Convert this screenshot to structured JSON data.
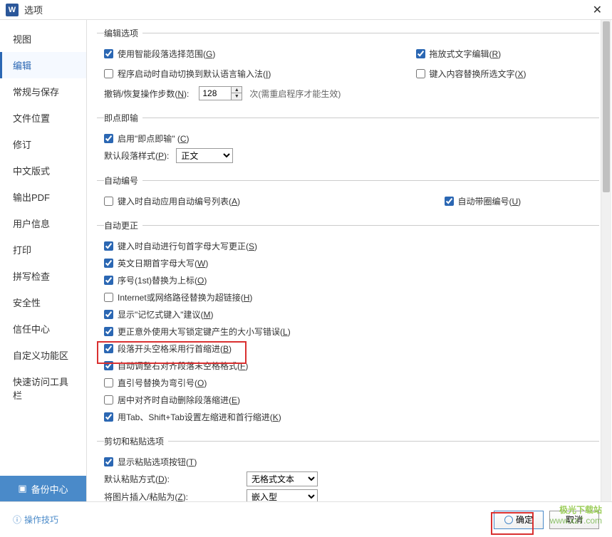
{
  "titlebar": {
    "title": "选项"
  },
  "sidebar": {
    "items": [
      "视图",
      "编辑",
      "常规与保存",
      "文件位置",
      "修订",
      "中文版式",
      "输出PDF",
      "用户信息",
      "打印",
      "拼写检查",
      "安全性",
      "信任中心",
      "自定义功能区",
      "快速访问工具栏"
    ],
    "selected_index": 1,
    "backup": "备份中心"
  },
  "sections": {
    "edit_options": {
      "legend": "编辑选项",
      "smart_select": "使用智能段落选择范围(G)",
      "drag_edit": "拖放式文字编辑(R)",
      "auto_ime": "程序启动时自动切换到默认语言输入法(I)",
      "replace_sel": "键入内容替换所选文字(X)",
      "undo_label": "撤销/恢复操作步数(N):",
      "undo_value": "128",
      "undo_hint": "次(需重启程序才能生效)"
    },
    "click_type": {
      "legend": "即点即输",
      "enable": "启用\"即点即输\" (C)",
      "style_label": "默认段落样式(P):",
      "style_value": "正文"
    },
    "auto_number": {
      "legend": "自动编号",
      "apply_list": "键入时自动应用自动编号列表(A)",
      "circle": "自动带圈编号(U)"
    },
    "auto_correct": {
      "legend": "自动更正",
      "cap_first": "键入时自动进行句首字母大写更正(S)",
      "cap_day": "英文日期首字母大写(W)",
      "ordinal": "序号(1st)替换为上标(O)",
      "hyperlink": "Internet或网络路径替换为超链接(H)",
      "memory": "显示\"记忆式键入\"建议(M)",
      "capslock": "更正意外使用大写锁定键产生的大小写错误(L)",
      "indent_empty": "段落开头空格采用行首缩进(B)",
      "align_space": "自动调整右对齐段落末空格格式(F)",
      "quotes": "直引号替换为弯引号(O)",
      "center_del": "居中对齐时自动删除段落缩进(E)",
      "tab_indent": "用Tab、Shift+Tab设置左缩进和首行缩进(K)"
    },
    "cut_paste": {
      "legend": "剪切和粘贴选项",
      "show_btn": "显示粘贴选项按钮(T)",
      "paste_label": "默认粘贴方式(D):",
      "paste_value": "无格式文本",
      "insert_label": "将图片插入/粘贴为(Z):",
      "insert_value": "嵌入型"
    }
  },
  "footer": {
    "tips": "操作技巧",
    "ok": "确定",
    "cancel": "取消"
  },
  "watermark": {
    "line1": "极光下载站",
    "line2": "www.xz7.com"
  }
}
